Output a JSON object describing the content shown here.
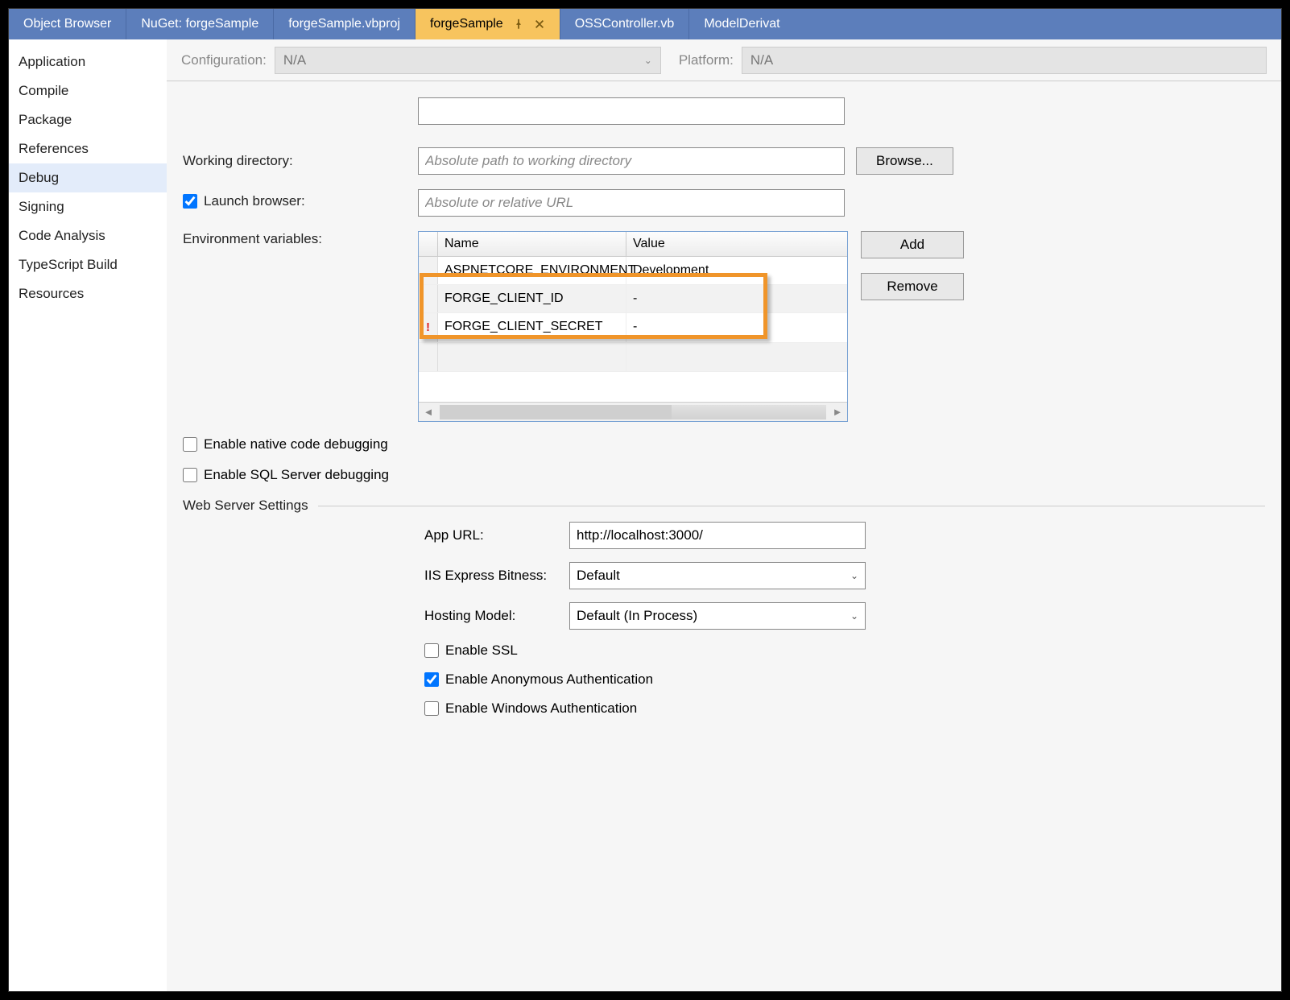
{
  "tabs": [
    {
      "label": "Object Browser",
      "active": false
    },
    {
      "label": "NuGet: forgeSample",
      "active": false
    },
    {
      "label": "forgeSample.vbproj",
      "active": false
    },
    {
      "label": "forgeSample",
      "active": true,
      "pinned": true,
      "closable": true
    },
    {
      "label": "OSSController.vb",
      "active": false
    },
    {
      "label": "ModelDerivat",
      "active": false
    }
  ],
  "sidebar": {
    "items": [
      "Application",
      "Compile",
      "Package",
      "References",
      "Debug",
      "Signing",
      "Code Analysis",
      "TypeScript Build",
      "Resources"
    ],
    "active": "Debug"
  },
  "configbar": {
    "configuration_label": "Configuration:",
    "configuration_value": "N/A",
    "platform_label": "Platform:",
    "platform_value": "N/A"
  },
  "form": {
    "working_dir_label": "Working directory:",
    "working_dir_placeholder": "Absolute path to working directory",
    "browse_label": "Browse...",
    "launch_browser_label": "Launch browser:",
    "launch_browser_placeholder": "Absolute or relative URL",
    "launch_browser_checked": true,
    "env_label": "Environment variables:",
    "env_headers": {
      "name": "Name",
      "value": "Value"
    },
    "env_rows": [
      {
        "name": "ASPNETCORE_ENVIRONMENT",
        "value": "Development",
        "alt": false,
        "err": false
      },
      {
        "name": "FORGE_CLIENT_ID",
        "value": "-",
        "alt": true,
        "err": false
      },
      {
        "name": "FORGE_CLIENT_SECRET",
        "value": "-",
        "alt": false,
        "err": true
      }
    ],
    "add_label": "Add",
    "remove_label": "Remove",
    "enable_native_label": "Enable native code debugging",
    "enable_sql_label": "Enable SQL Server debugging"
  },
  "webserver": {
    "section_title": "Web Server Settings",
    "app_url_label": "App URL:",
    "app_url_value": "http://localhost:3000/",
    "iis_bitness_label": "IIS Express Bitness:",
    "iis_bitness_value": "Default",
    "hosting_model_label": "Hosting Model:",
    "hosting_model_value": "Default (In Process)",
    "enable_ssl_label": "Enable SSL",
    "enable_anon_label": "Enable Anonymous Authentication",
    "enable_anon_checked": true,
    "enable_win_label": "Enable Windows Authentication"
  }
}
